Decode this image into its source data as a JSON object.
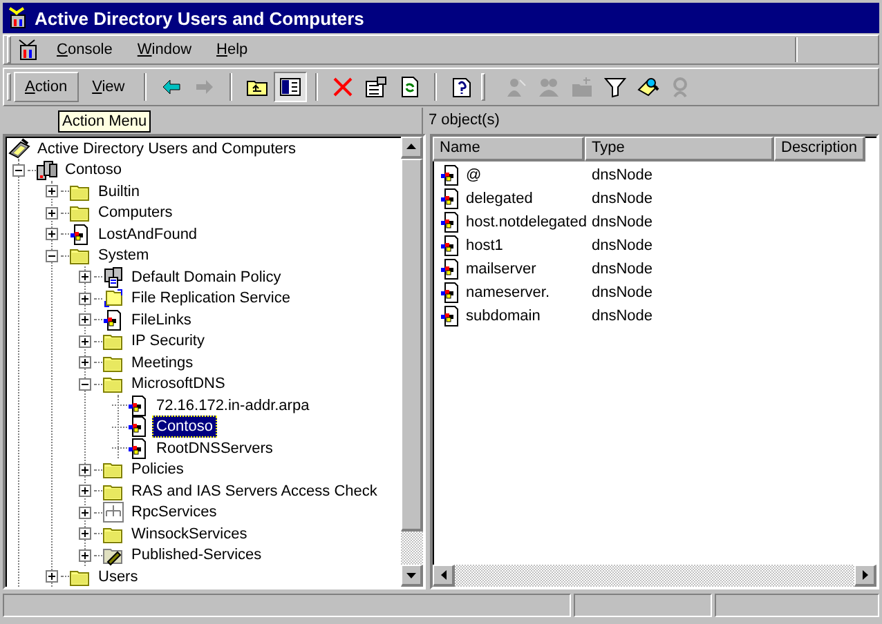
{
  "window": {
    "title": "Active Directory Users and Computers"
  },
  "menu_bar": [
    {
      "label": "Console"
    },
    {
      "label": "Window"
    },
    {
      "label": "Help"
    }
  ],
  "action_bar": [
    {
      "label": "Action",
      "selected": true
    },
    {
      "label": "View",
      "selected": false
    }
  ],
  "toolbar_groups": [
    [
      {
        "kind": "back",
        "disabled": false,
        "pressed": false
      },
      {
        "kind": "forward",
        "disabled": true,
        "pressed": false
      }
    ],
    [
      {
        "kind": "up",
        "disabled": false,
        "pressed": false
      },
      {
        "kind": "tree",
        "disabled": false,
        "pressed": true
      }
    ],
    [
      {
        "kind": "delete",
        "disabled": false,
        "pressed": false
      },
      {
        "kind": "properties",
        "disabled": false,
        "pressed": false
      },
      {
        "kind": "refresh",
        "disabled": false,
        "pressed": false
      }
    ],
    [
      {
        "kind": "help",
        "disabled": false,
        "pressed": false
      }
    ],
    [
      {
        "kind": "new-user",
        "disabled": true,
        "pressed": false
      },
      {
        "kind": "new-group",
        "disabled": true,
        "pressed": false
      },
      {
        "kind": "new-folder",
        "disabled": true,
        "pressed": false
      },
      {
        "kind": "filter",
        "disabled": false,
        "pressed": false
      },
      {
        "kind": "find",
        "disabled": false,
        "pressed": false
      },
      {
        "kind": "add-member",
        "disabled": true,
        "pressed": false
      }
    ]
  ],
  "tooltip": "Action Menu",
  "list_status": "7 object(s)",
  "tree": {
    "label": "Active Directory Users and Computers",
    "kind": "snapin",
    "selected": false,
    "children": [
      {
        "label": "Contoso",
        "kind": "domain",
        "expanded": true,
        "selected": false,
        "children": [
          {
            "label": "Builtin",
            "kind": "folder",
            "expanded": false,
            "selected": false
          },
          {
            "label": "Computers",
            "kind": "folder",
            "expanded": false,
            "selected": false
          },
          {
            "label": "LostAndFound",
            "kind": "zone",
            "expanded": false,
            "selected": false
          },
          {
            "label": "System",
            "kind": "folder",
            "expanded": true,
            "selected": false,
            "children": [
              {
                "label": "Default Domain Policy",
                "kind": "policy",
                "expanded": false,
                "selected": false
              },
              {
                "label": "File Replication Service",
                "kind": "replication",
                "expanded": false,
                "selected": false
              },
              {
                "label": "FileLinks",
                "kind": "zone",
                "expanded": false,
                "selected": false
              },
              {
                "label": "IP Security",
                "kind": "folder",
                "expanded": false,
                "selected": false
              },
              {
                "label": "Meetings",
                "kind": "folder",
                "expanded": false,
                "selected": false
              },
              {
                "label": "MicrosoftDNS",
                "kind": "folder",
                "expanded": true,
                "selected": false,
                "children": [
                  {
                    "label": "72.16.172.in-addr.arpa",
                    "kind": "zone",
                    "selected": false
                  },
                  {
                    "label": "Contoso",
                    "kind": "zone",
                    "selected": true
                  },
                  {
                    "label": "RootDNSServers",
                    "kind": "zone",
                    "selected": false
                  }
                ]
              },
              {
                "label": "Policies",
                "kind": "folder",
                "expanded": false,
                "selected": false
              },
              {
                "label": "RAS and IAS Servers Access Check",
                "kind": "folder",
                "expanded": false,
                "selected": false
              },
              {
                "label": "RpcServices",
                "kind": "rpc",
                "expanded": false,
                "selected": false
              },
              {
                "label": "WinsockServices",
                "kind": "folder",
                "expanded": false,
                "selected": false
              },
              {
                "label": "Published-Services",
                "kind": "published",
                "expanded": false,
                "selected": false
              }
            ]
          },
          {
            "label": "Users",
            "kind": "folder",
            "expanded": false,
            "selected": false
          }
        ]
      }
    ]
  },
  "list": {
    "columns": [
      "Name",
      "Type",
      "Description"
    ],
    "rows": [
      {
        "name": "@",
        "type": "dnsNode"
      },
      {
        "name": "delegated",
        "type": "dnsNode"
      },
      {
        "name": "host.notdelegated",
        "type": "dnsNode"
      },
      {
        "name": "host1",
        "type": "dnsNode"
      },
      {
        "name": "mailserver",
        "type": "dnsNode"
      },
      {
        "name": "nameserver.",
        "type": "dnsNode"
      },
      {
        "name": "subdomain",
        "type": "dnsNode"
      }
    ]
  }
}
